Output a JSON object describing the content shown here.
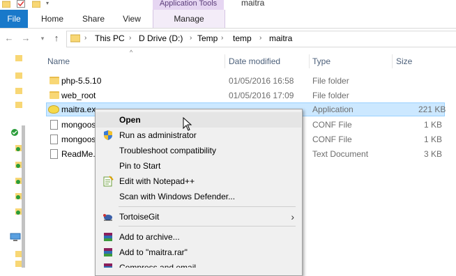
{
  "window": {
    "title": "maitra"
  },
  "ribbon": {
    "contextual_group": "Application Tools",
    "tabs": [
      {
        "label": "File"
      },
      {
        "label": "Home"
      },
      {
        "label": "Share"
      },
      {
        "label": "View"
      },
      {
        "label": "Manage"
      }
    ]
  },
  "address": {
    "crumbs": [
      "This PC",
      "D Drive (D:)",
      "Temp",
      "temp",
      "maitra"
    ]
  },
  "columns": {
    "name": "Name",
    "date": "Date modified",
    "type": "Type",
    "size": "Size"
  },
  "files": [
    {
      "name": "php-5.5.10",
      "date": "01/05/2016 16:58",
      "type": "File folder",
      "size": "",
      "icon": "folder-icon"
    },
    {
      "name": "web_root",
      "date": "01/05/2016 17:09",
      "type": "File folder",
      "size": "",
      "icon": "folder-icon"
    },
    {
      "name": "maitra.ex",
      "date": "",
      "type": "Application",
      "size": "221 KB",
      "icon": "app-icon"
    },
    {
      "name": "mongoos",
      "date": "",
      "type": "CONF File",
      "size": "1 KB",
      "icon": "doc-icon"
    },
    {
      "name": "mongoos",
      "date": "",
      "type": "CONF File",
      "size": "1 KB",
      "icon": "doc-icon"
    },
    {
      "name": "ReadMe.t",
      "date": "",
      "type": "Text Document",
      "size": "3 KB",
      "icon": "doc-icon"
    }
  ],
  "context_menu": {
    "items": [
      {
        "label": "Open",
        "icon": "",
        "bold": true
      },
      {
        "label": "Run as administrator",
        "icon": "uac-shield-icon"
      },
      {
        "label": "Troubleshoot compatibility",
        "icon": ""
      },
      {
        "label": "Pin to Start",
        "icon": ""
      },
      {
        "label": "Edit with Notepad++",
        "icon": "notepad-plus-plus-icon"
      },
      {
        "label": "Scan with Windows Defender...",
        "icon": ""
      },
      {
        "label": "TortoiseGit",
        "icon": "tortoisegit-icon",
        "submenu": true
      },
      {
        "label": "Add to archive...",
        "icon": "winrar-icon"
      },
      {
        "label": "Add to \"maitra.rar\"",
        "icon": "winrar-icon"
      },
      {
        "label": "Compress and email...",
        "icon": "winrar-icon"
      }
    ]
  },
  "colors": {
    "file_tab": "#1979ca",
    "contextual_tab": "#e6d6f2",
    "selection": "#cce8ff",
    "selection_border": "#99d1ff",
    "menu_bg": "#f0f0f0",
    "folder": "#f8d775"
  }
}
